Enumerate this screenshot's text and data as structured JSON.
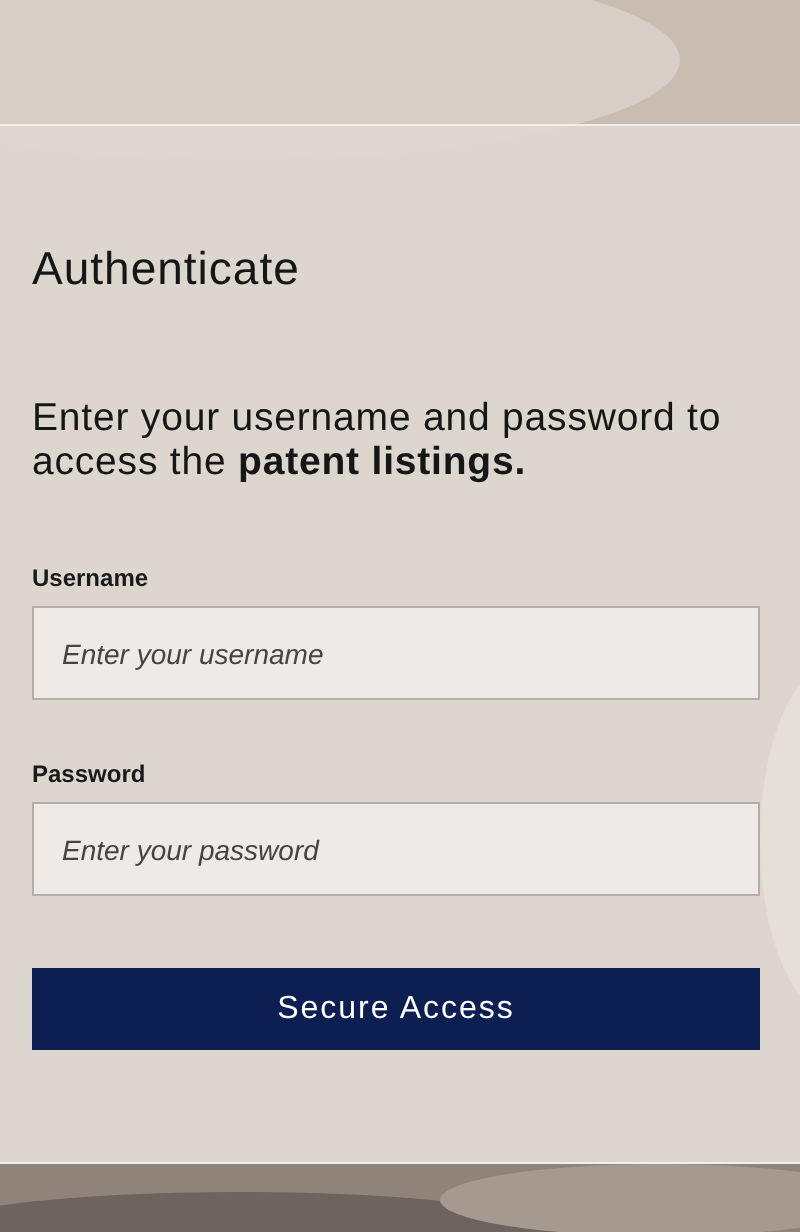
{
  "title": "Authenticate",
  "intro": "Enter your username and password to access the **patent listings.**",
  "fields": [
    {
      "label": "Username",
      "placeholder": "Enter your username"
    },
    {
      "label": "Password",
      "placeholder": "Enter your password"
    }
  ],
  "submit": "Secure Access"
}
